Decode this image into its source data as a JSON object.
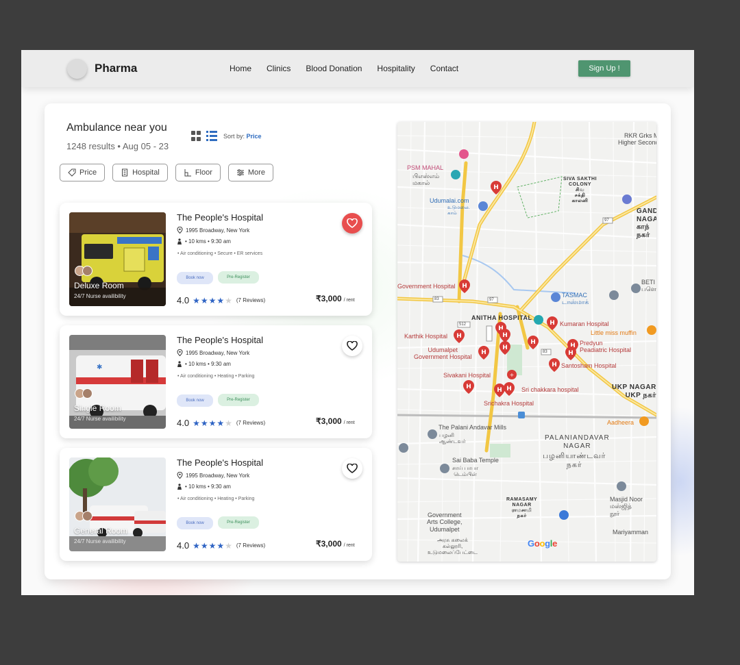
{
  "nav": {
    "brand": "Pharma",
    "links": [
      "Home",
      "Clinics",
      "Blood Donation",
      "Hospitality",
      "Contact"
    ],
    "signup_label": "Sign Up !"
  },
  "header": {
    "title": "Ambulance near you",
    "subtitle": "1248 results • Aug 05 - 23",
    "sort_prefix": "Sort by:",
    "sort_value": "Price"
  },
  "filters": [
    "Price",
    "Hospital",
    "Floor",
    "More"
  ],
  "cards": [
    {
      "name": "The People's Hospital",
      "address": "1995 Broadway, New York",
      "distance": "• 10 kms • 9:30 am",
      "amenities": "• Air conditioning • Secure • ER services",
      "room": "Deluxe Room",
      "nurse": "24/7 Nurse availibility",
      "book_label": "Book now",
      "pre_label": "Pre-Register",
      "rating": "4.0",
      "reviews": "(7 Reviews)",
      "price": "₹3,000",
      "price_unit": "/ rent",
      "favorited": true
    },
    {
      "name": "The People's Hospital",
      "address": "1995 Broadway, New York",
      "distance": "• 10 kms • 9:30 am",
      "amenities": "• Air conditioning • Heating • Parking",
      "room": "Single Room",
      "nurse": "24/7 Nurse availibility",
      "book_label": "Book now",
      "pre_label": "Pre-Register",
      "rating": "4.0",
      "reviews": "(7 Reviews)",
      "price": "₹3,000",
      "price_unit": "/ rent",
      "favorited": false
    },
    {
      "name": "The People's Hospital",
      "address": "1995 Broadway, New York",
      "distance": "• 10 kms • 9:30 am",
      "amenities": "• Air conditioning • Heating • Parking",
      "room": "General Room",
      "nurse": "24/7 Nurse availibility",
      "book_label": "Book now",
      "pre_label": "Pre-Register",
      "rating": "4.0",
      "reviews": "(7 Reviews)",
      "price": "₹3,000",
      "price_unit": "/ rent",
      "favorited": false
    }
  ],
  "map": {
    "labels": {
      "psm": "PSM MAHAL",
      "psm_ta": "பிஎஸ்எம்\nமகால்",
      "rkr": "RKR Grks M\nHigher Second",
      "sivasakthi": "SIVA SAKTHI\nCOLONY\nசிவ\nசக்தி\nகாலனி",
      "udumalai": "Udumalai.com",
      "udumalai_ta": "உடுமலை.\nகாம்",
      "gandhi": "GAND\nNAGA\nகாந்\nநகர்",
      "govt_hospital": "Government Hospital",
      "tasmac": "TASMAC\nடாஸ்மாக்",
      "beti": "BETI\nபளெ",
      "anitha": "ANITHA HOSPITAL",
      "kumaran": "Kumaran Hospital",
      "little_miss": "Little miss muffin",
      "karthik": "Karthik Hospital",
      "udumalpet_govt": "Udumalpet\nGovernment Hospital",
      "predyun": "Predyun\nPeadiatric Hospital",
      "santosham": "Santosham Hospital",
      "sivakani": "Sivakani Hospital",
      "sri_chakkara": "Sri chakkara hospital",
      "srichakra": "Srichakra Hospital",
      "ukp": "UKP NAGAR\nUKP நகர்",
      "aadheera": "Aadheera",
      "palani_mills": "The Palani Andavar Mills",
      "palani_mills_ta": "பழனி\nஆண்டவர்",
      "palaniandavar": "PALANIANDAVAR\nNAGAR",
      "palaniandavar_ta": "பழனியாண்டவர்\nநகர்",
      "saibaba": "Sai Baba Temple",
      "saibaba_ta": "சாய் பாபா\nடெம்பிள்",
      "ramasamy": "RAMASAMY\nNAGAR\nராமசாமி\nநகர்",
      "masjid": "Masjid Noor\nமஸ்ஜித்\nநூர்",
      "mariyamman": "Mariyamman",
      "govt_college": "Government\nArts College,\nUdumalpet",
      "govt_college_ta": "அரசு கலைக்\nகல்லூரி,\nஉடுமலைப்பேட்டை",
      "route_83a": "83",
      "route_97a": "97",
      "route_97b": "97",
      "route_512": "512",
      "route_83b": "83"
    },
    "attribution": [
      "G",
      "o",
      "o",
      "g",
      "l",
      "e"
    ]
  },
  "colors": {
    "accent": "#2f64c4",
    "signup_bg": "#4f9570",
    "fav_active": "#e84e4e",
    "map_road_major": "#f2c744",
    "marker": "#d83b36"
  }
}
